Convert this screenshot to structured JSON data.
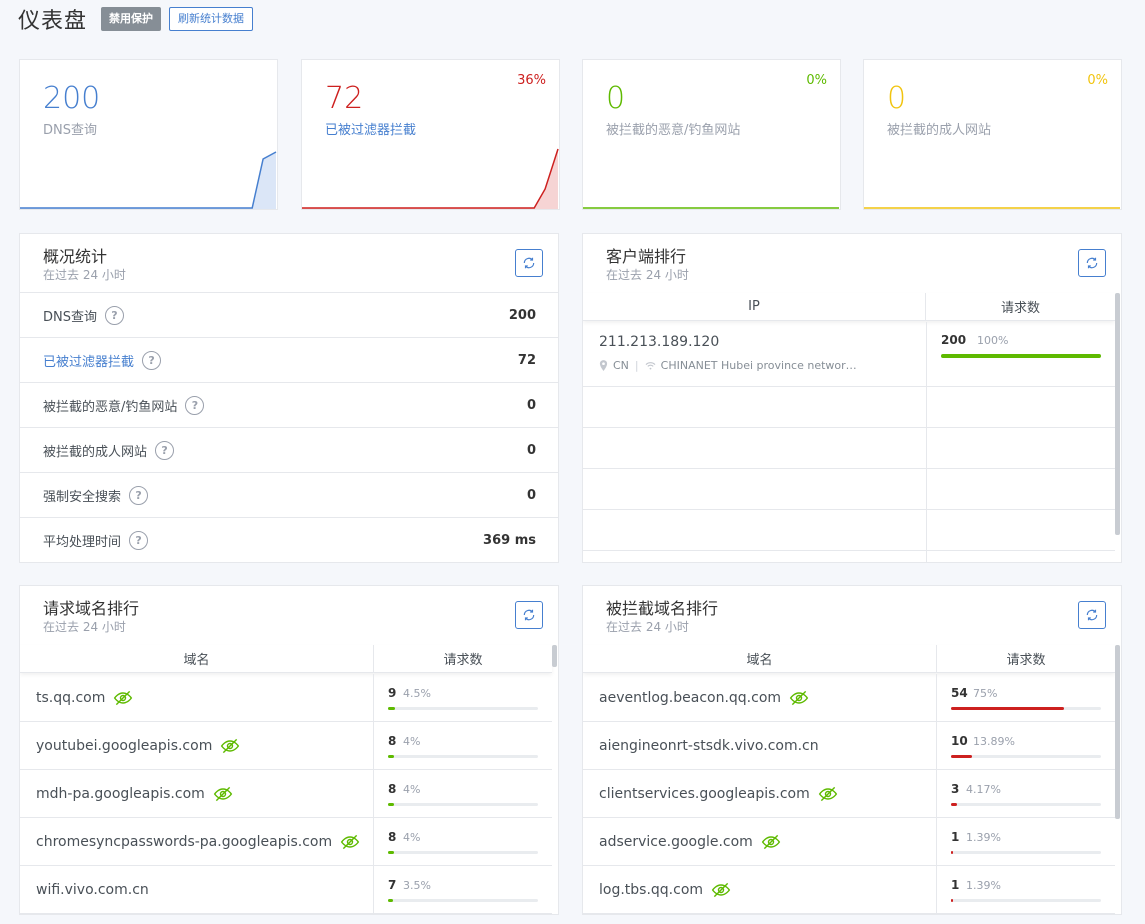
{
  "header": {
    "title": "仪表盘",
    "disable_button": "禁用保护",
    "refresh_button": "刷新统计数据"
  },
  "stats": [
    {
      "value": "200",
      "label": "DNS查询",
      "percent": "",
      "color": "#467fcf"
    },
    {
      "value": "72",
      "label": "已被过滤器拦截",
      "percent": "36%",
      "color": "#cd201f"
    },
    {
      "value": "0",
      "label": "被拦截的恶意/钓鱼网站",
      "percent": "0%",
      "color": "#5eba00"
    },
    {
      "value": "0",
      "label": "被拦截的成人网站",
      "percent": "0%",
      "color": "#f1c40f"
    }
  ],
  "overview": {
    "title": "概况统计",
    "subtitle": "在过去 24 小时",
    "rows": [
      {
        "label": "DNS查询",
        "value": "200"
      },
      {
        "label": "已被过滤器拦截",
        "value": "72"
      },
      {
        "label": "被拦截的恶意/钓鱼网站",
        "value": "0"
      },
      {
        "label": "被拦截的成人网站",
        "value": "0"
      },
      {
        "label": "强制安全搜索",
        "value": "0"
      },
      {
        "label": "平均处理时间",
        "value": "369 ms"
      }
    ]
  },
  "clients": {
    "title": "客户端排行",
    "subtitle": "在过去 24 小时",
    "col_ip": "IP",
    "col_requests": "请求数",
    "rows": [
      {
        "ip": "211.213.189.120",
        "country": "CN",
        "network": "CHINANET Hubei province networ…",
        "count": "200",
        "percent": "100%",
        "fraction": 1.0
      }
    ]
  },
  "top_queried": {
    "title": "请求域名排行",
    "subtitle": "在过去 24 小时",
    "col_domain": "域名",
    "col_requests": "请求数",
    "rows": [
      {
        "domain": "ts.qq.com",
        "count": "9",
        "percent": "4.5%",
        "fraction": 0.045,
        "tracker": true
      },
      {
        "domain": "youtubei.googleapis.com",
        "count": "8",
        "percent": "4%",
        "fraction": 0.04,
        "tracker": true
      },
      {
        "domain": "mdh-pa.googleapis.com",
        "count": "8",
        "percent": "4%",
        "fraction": 0.04,
        "tracker": true
      },
      {
        "domain": "chromesyncpasswords-pa.googleapis.com",
        "count": "8",
        "percent": "4%",
        "fraction": 0.04,
        "tracker": true
      },
      {
        "domain": "wifi.vivo.com.cn",
        "count": "7",
        "percent": "3.5%",
        "fraction": 0.035,
        "tracker": false
      }
    ]
  },
  "top_blocked": {
    "title": "被拦截域名排行",
    "subtitle": "在过去 24 小时",
    "col_domain": "域名",
    "col_requests": "请求数",
    "rows": [
      {
        "domain": "aeventlog.beacon.qq.com",
        "count": "54",
        "percent": "75%",
        "fraction": 0.75,
        "tracker": true
      },
      {
        "domain": "aiengineonrt-stsdk.vivo.com.cn",
        "count": "10",
        "percent": "13.89%",
        "fraction": 0.1389,
        "tracker": false
      },
      {
        "domain": "clientservices.googleapis.com",
        "count": "3",
        "percent": "4.17%",
        "fraction": 0.0417,
        "tracker": true
      },
      {
        "domain": "adservice.google.com",
        "count": "1",
        "percent": "1.39%",
        "fraction": 0.0139,
        "tracker": true
      },
      {
        "domain": "log.tbs.qq.com",
        "count": "1",
        "percent": "1.39%",
        "fraction": 0.0139,
        "tracker": true
      }
    ]
  },
  "colors": {
    "blue": "#467fcf",
    "red": "#cd201f",
    "green": "#5eba00",
    "yellow": "#f1c40f",
    "tracker_icon": "#5eba00"
  },
  "icons": {
    "refresh": "refresh-icon",
    "help": "help-circle-icon",
    "tracker": "eye-slash-icon",
    "location": "map-pin-icon",
    "network": "wifi-icon"
  }
}
